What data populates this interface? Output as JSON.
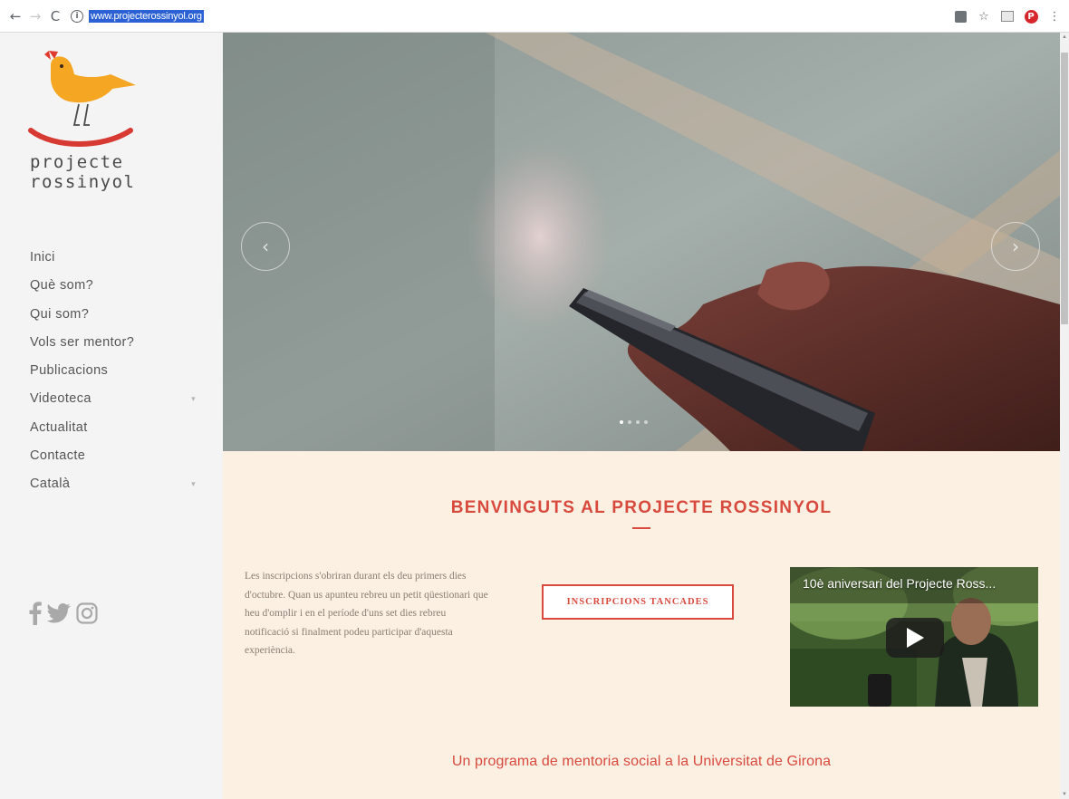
{
  "browser": {
    "url": "www.projecterossinyol.org",
    "back_icon": "←",
    "forward_icon": "→",
    "reload_icon": "C",
    "info_icon": "i",
    "bookmark_icon": "☆",
    "menu_icon": "⋮",
    "pinterest_icon": "P"
  },
  "sidebar": {
    "brand_line1": "projecte",
    "brand_line2": "rossinyol",
    "menu": [
      {
        "label": "Inici",
        "has_submenu": false
      },
      {
        "label": "Què som?",
        "has_submenu": false
      },
      {
        "label": "Qui som?",
        "has_submenu": false
      },
      {
        "label": "Vols ser mentor?",
        "has_submenu": false
      },
      {
        "label": "Publicacions",
        "has_submenu": false
      },
      {
        "label": "Videoteca",
        "has_submenu": true
      },
      {
        "label": "Actualitat",
        "has_submenu": false
      },
      {
        "label": "Contacte",
        "has_submenu": false
      },
      {
        "label": "Català",
        "has_submenu": true
      }
    ],
    "submenu_caret": "▾",
    "social_icons": [
      "facebook-icon",
      "twitter-icon",
      "instagram-icon"
    ]
  },
  "hero": {
    "prev_icon": "‹",
    "next_icon": "›",
    "slide_count": 4,
    "active_slide": 1
  },
  "content": {
    "welcome_title": "BENVINGUTS AL PROJECTE ROSSINYOL",
    "description": "Les inscripcions s'obriran durant els deu primers dies d'octubre. Quan us apunteu rebreu un petit qüestionari que heu d'omplir i en el període d'uns set dies rebreu notificació si finalment podeu participar d'aquesta experiència.",
    "cta_label": "INSCRIPCIONS TANCADES",
    "video_title": "10è aniversari del Projecte Ross...",
    "tagline": "Un programa de mentoria social a la Universitat de Girona"
  },
  "colors": {
    "accent": "#d84a3e",
    "sidebar_bg": "#f4f4f4",
    "content_bg": "#fbf0e2",
    "bird": "#f5a623"
  }
}
